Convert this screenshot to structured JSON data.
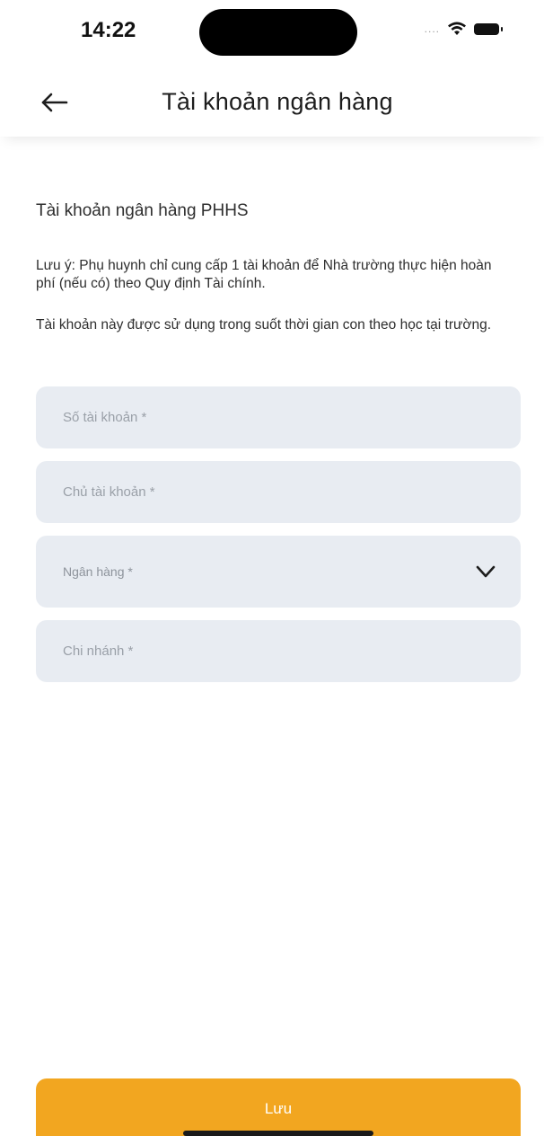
{
  "status_bar": {
    "time": "14:22",
    "signal_dots": "....",
    "icons": [
      "wifi-icon",
      "battery-icon"
    ]
  },
  "header": {
    "back_icon": "arrow-left-icon",
    "title": "Tài khoản ngân hàng"
  },
  "main": {
    "section_title": "Tài khoản ngân hàng PHHS",
    "note_1": "Lưu ý: Phụ huynh chỉ cung cấp 1 tài khoản để Nhà trường thực hiện hoàn phí (nếu có) theo Quy định Tài chính.",
    "note_2": "Tài khoản này được sử dụng trong suốt thời gian con theo học tại trường.",
    "fields": {
      "account_number": {
        "value": "",
        "placeholder": "Số tài khoản *"
      },
      "account_owner": {
        "value": "",
        "placeholder": "Chủ tài khoản *"
      },
      "bank": {
        "selected": "Ngân hàng *",
        "icon": "chevron-down-icon"
      },
      "branch": {
        "value": "",
        "placeholder": "Chi nhánh *"
      }
    }
  },
  "footer": {
    "save_label": "Lưu",
    "accent_color": "#f2a620"
  },
  "colors": {
    "field_bg": "#e8ecf2",
    "placeholder": "#9aa0a8"
  }
}
